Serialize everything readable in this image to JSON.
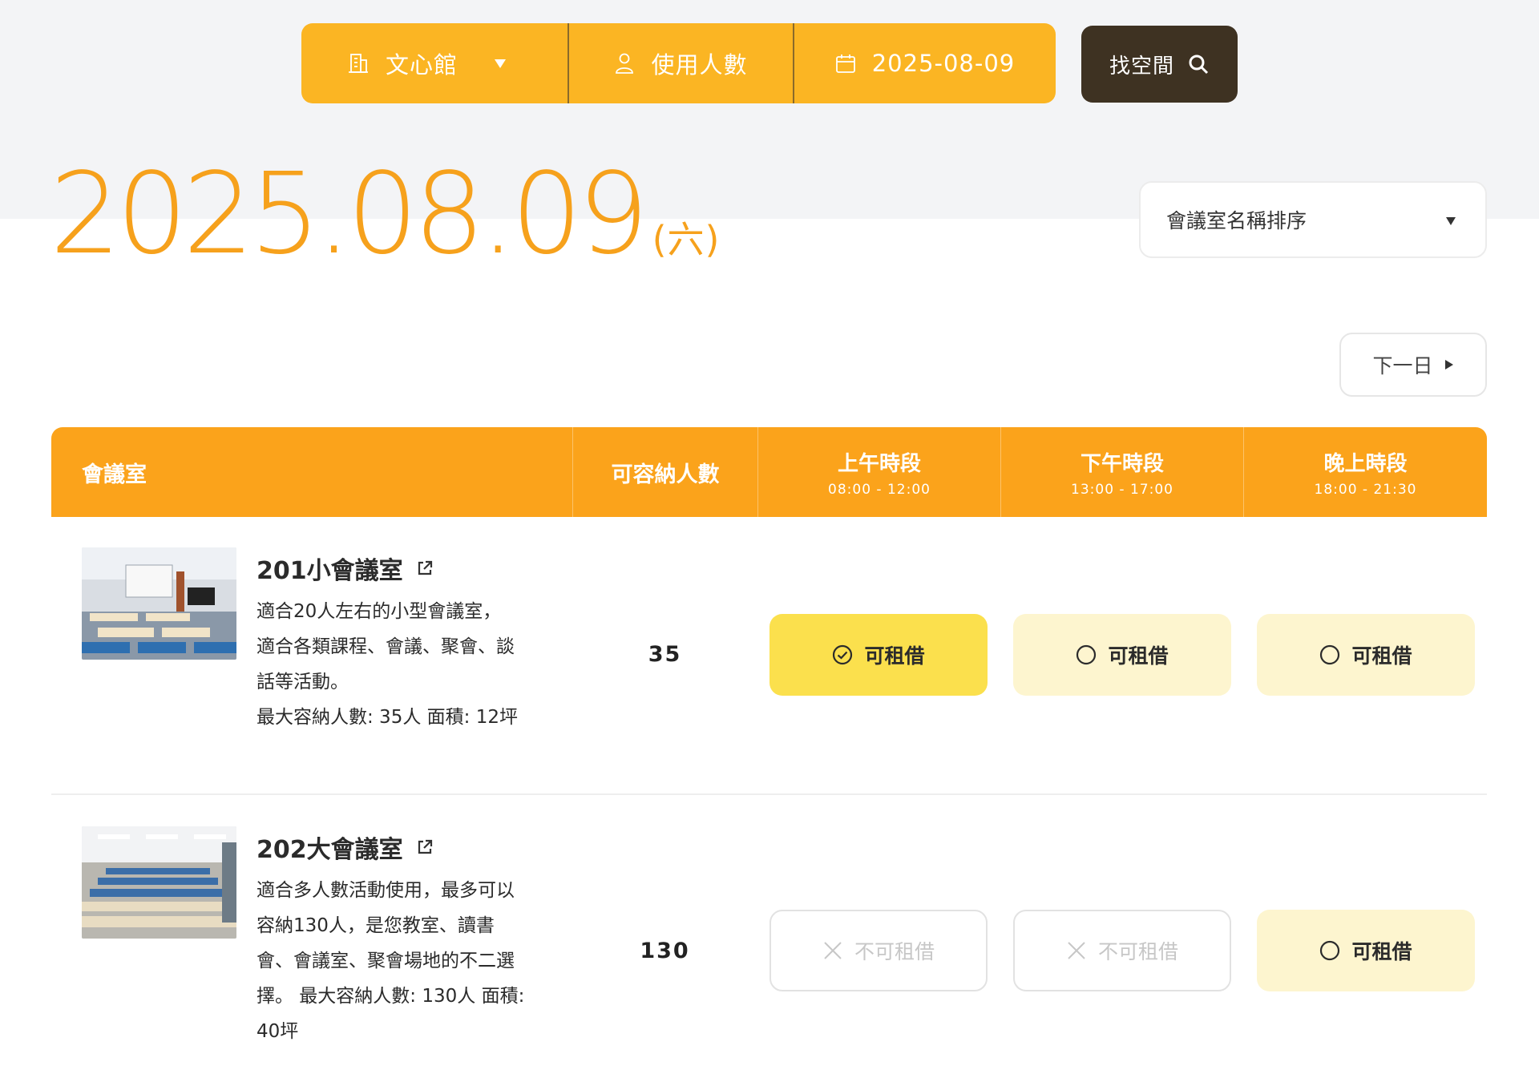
{
  "search": {
    "venue": "文心館",
    "people_placeholder": "使用人數",
    "date": "2025-08-09",
    "find_label": "找空間"
  },
  "date_display": {
    "digits": "2025.08.09",
    "weekday": "(六)"
  },
  "sort": {
    "selected": "會議室名稱排序"
  },
  "next_day_label": "下一日",
  "table": {
    "headers": {
      "room": "會議室",
      "capacity": "可容納人數",
      "morning": {
        "label": "上午時段",
        "time": "08:00 - 12:00"
      },
      "afternoon": {
        "label": "下午時段",
        "time": "13:00 - 17:00"
      },
      "evening": {
        "label": "晚上時段",
        "time": "18:00 - 21:30"
      }
    },
    "rows": [
      {
        "name": "201小會議室",
        "description_lines": [
          "適合20人左右的小型會議室，",
          "適合各類課程、會議、聚會、談",
          "話等活動。",
          "最大容納人數: 35人 面積: 12坪"
        ],
        "capacity": "35",
        "slots": [
          {
            "label": "可租借",
            "state": "selected"
          },
          {
            "label": "可租借",
            "state": "available"
          },
          {
            "label": "可租借",
            "state": "available"
          }
        ]
      },
      {
        "name": "202大會議室",
        "description_lines": [
          "適合多人數活動使用，最多可以",
          "容納130人，是您教室、讀書",
          "會、會議室、聚會場地的不二選",
          "擇。 最大容納人數: 130人 面積:",
          "40坪"
        ],
        "capacity": "130",
        "slots": [
          {
            "label": "不可租借",
            "state": "unavailable"
          },
          {
            "label": "不可租借",
            "state": "unavailable"
          },
          {
            "label": "可租借",
            "state": "available"
          }
        ]
      }
    ]
  },
  "colors": {
    "brand_yellow": "#fbb523",
    "header_orange": "#fba31b",
    "date_orange": "#f6a11c",
    "dark_button": "#3e3222",
    "selected_slot": "#fbe04d",
    "available_slot": "#fdf5cf"
  },
  "icons": {
    "venue": "building-icon",
    "people": "user-icon",
    "date": "calendar-icon",
    "find": "search-icon",
    "external": "external-link-icon",
    "selected_slot": "check-circle-icon",
    "available_slot": "circle-icon",
    "unavailable_slot": "x-icon"
  }
}
